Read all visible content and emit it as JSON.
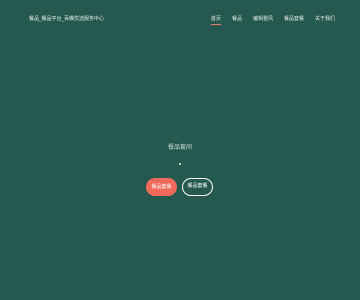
{
  "header": {
    "brand": "餐品_餐品平台_百曝优选服务中心",
    "nav": [
      {
        "label": "首页",
        "active": true
      },
      {
        "label": "餐品",
        "active": false
      },
      {
        "label": "编辑整风",
        "active": false
      },
      {
        "label": "餐品套餐",
        "active": false
      },
      {
        "label": "关于我们",
        "active": false
      }
    ]
  },
  "hero": {
    "title": "餐品套间",
    "dot": ".",
    "primary_button": "餐品套餐",
    "secondary_button": "餐品套餐"
  },
  "colors": {
    "background": "#25594f",
    "accent": "#ef6a5b"
  }
}
